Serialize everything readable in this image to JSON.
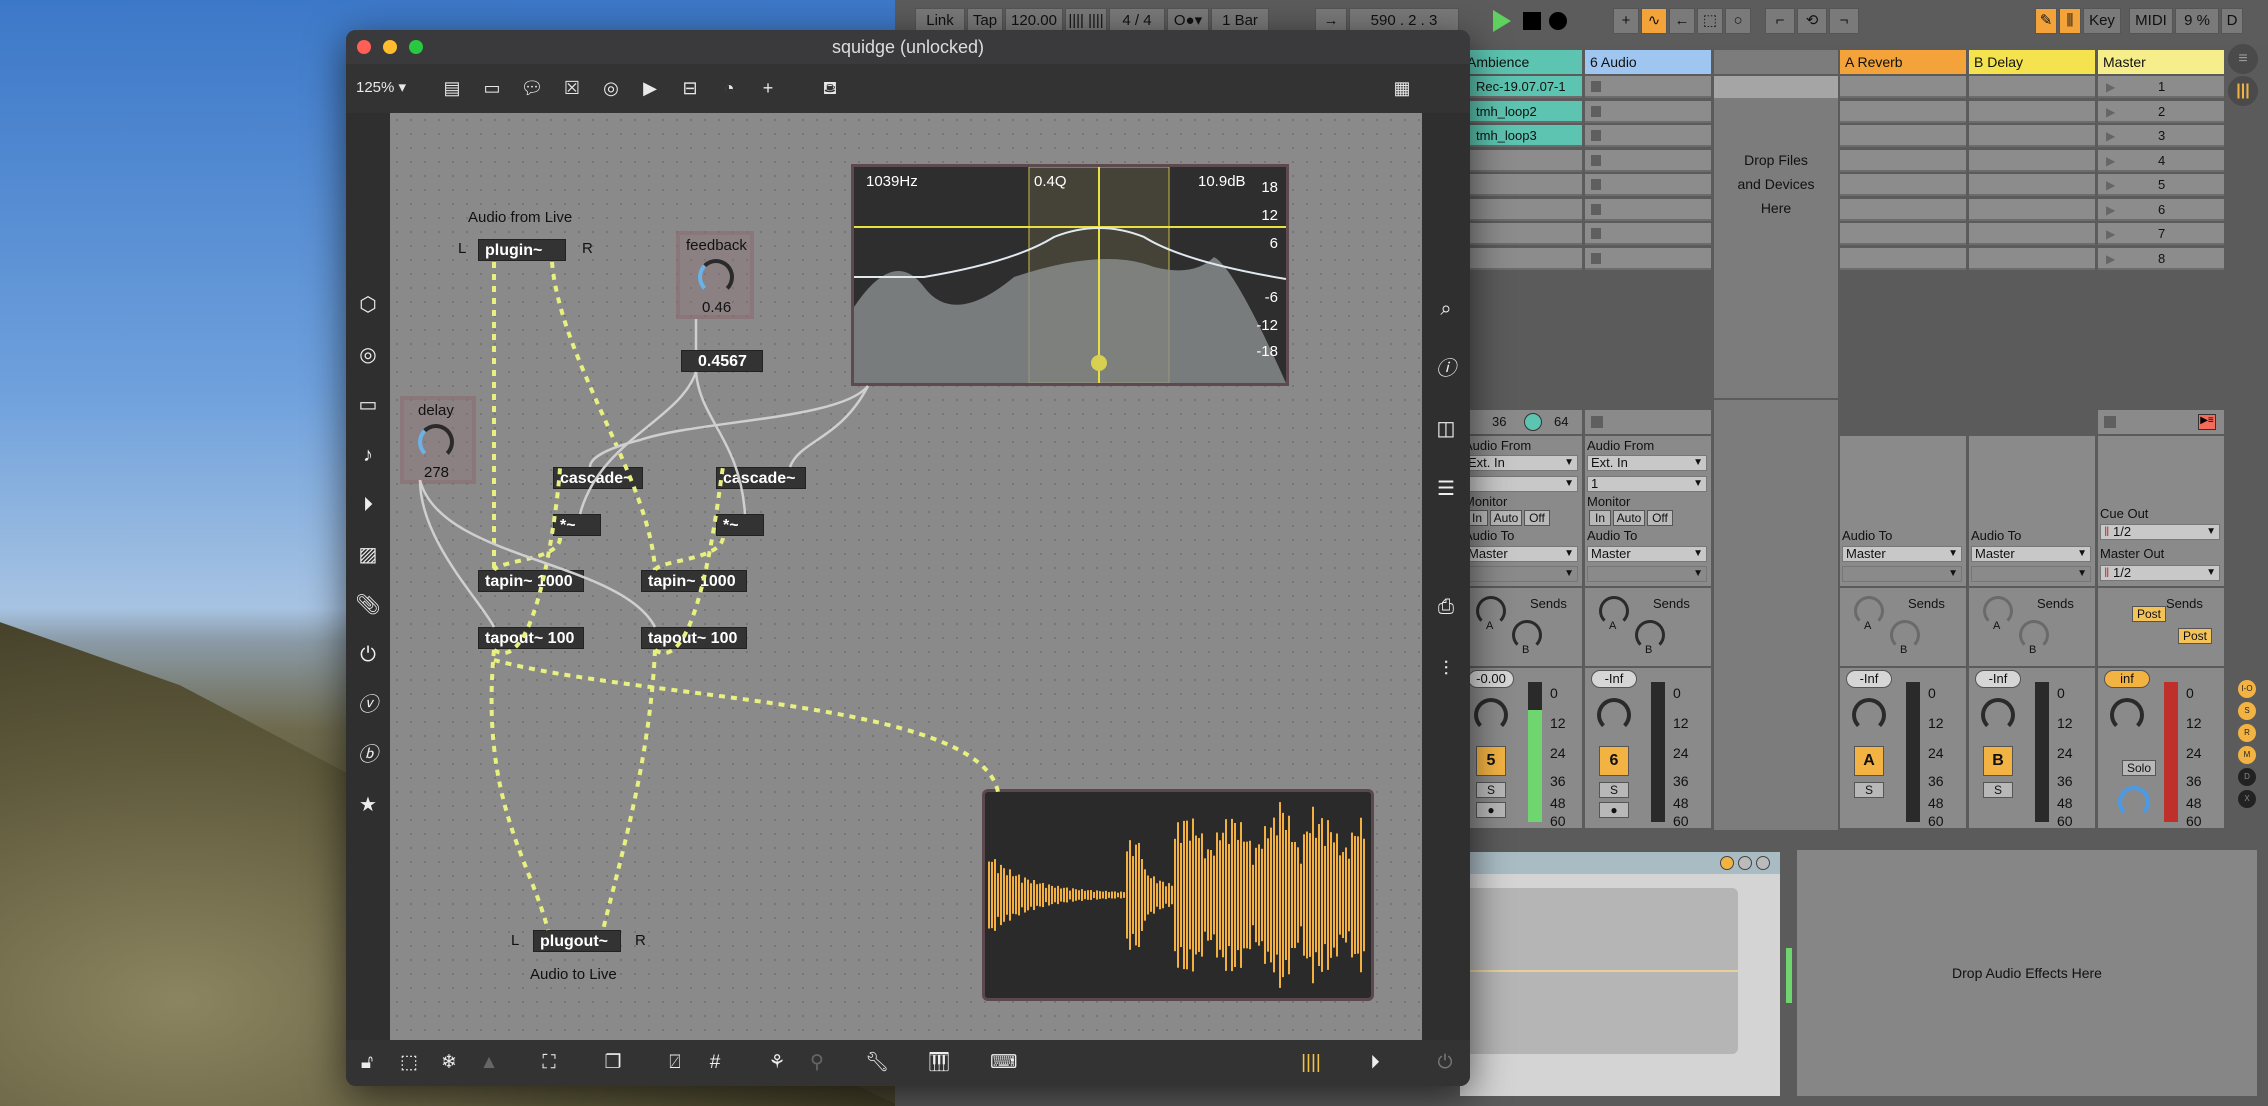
{
  "max_window": {
    "title": "squidge (unlocked)",
    "zoom": "125%",
    "toolbar_icons": [
      "object-box-icon",
      "message-box-icon",
      "comment-icon",
      "toggle-icon",
      "button-icon",
      "play-icon",
      "slider-icon",
      "dial-icon",
      "add-icon",
      "paint-bucket-icon",
      "grid-icon"
    ],
    "left_sidebar_icons": [
      "packages-icon",
      "target-icon",
      "device-icon",
      "music-note-icon",
      "video-icon",
      "image-icon",
      "paperclip-icon",
      "plug-icon",
      "v-icon",
      "b-icon",
      "star-icon"
    ],
    "right_sidebar_icons": [
      "search-icon",
      "info-icon",
      "columns-icon",
      "list-icon",
      "camera-icon",
      "mixer-icon"
    ],
    "bottom_icons": [
      "lock-icon",
      "presentation-icon",
      "freeze-icon",
      "warning-icon",
      "easel-icon",
      "layers-icon",
      "hide-icon",
      "grid-icon",
      "tree-icon",
      "attach-icon",
      "wrench-icon",
      "piano-icon",
      "keyboard-icon",
      "meter-icon",
      "play-circle-icon",
      "power-icon"
    ]
  },
  "patch": {
    "comments": {
      "audio_from_live": "Audio from Live",
      "audio_to_live": "Audio to Live",
      "plugin_L": "L",
      "plugin_R": "R",
      "plugout_L": "L",
      "plugout_R": "R"
    },
    "objects": {
      "plugin": "plugin~",
      "plugout": "plugout~",
      "cascade1": "cascade~",
      "cascade2": "cascade~",
      "mul1": "*~",
      "mul2": "*~",
      "tapin1": "tapin~ 1000",
      "tapin2": "tapin~ 1000",
      "tapout1": "tapout~ 100",
      "tapout2": "tapout~ 100"
    },
    "feedback_dial": {
      "label": "feedback",
      "value": "0.46",
      "fraction": 0.46
    },
    "delay_dial": {
      "label": "delay",
      "value": "278"
    },
    "number_box": "0.4567",
    "filtergraph": {
      "freq": "1039Hz",
      "q": "0.4Q",
      "gain": "10.9dB",
      "db_labels": [
        "18",
        "12",
        "6",
        "-6",
        "-12",
        "-18"
      ]
    }
  },
  "live": {
    "transport": {
      "link": "Link",
      "tap": "Tap",
      "tempo": "120.00",
      "signature": "4 / 4",
      "quantize": "1 Bar",
      "position": "590 .  2 .  3",
      "key": "Key",
      "midi": "MIDI",
      "cpu": "9 %",
      "d": "D"
    },
    "tracks": [
      {
        "name": "Ambience",
        "color": "#5cc4b0",
        "clips": [
          "Rec-19.07.07-1",
          "tmh_loop2",
          "tmh_loop3"
        ]
      },
      {
        "name": "6 Audio",
        "color": "#9fc6f0",
        "clips": []
      },
      {
        "name": "A Reverb",
        "color": "#f3a33a"
      },
      {
        "name": "B Delay",
        "color": "#f4e34e"
      },
      {
        "name": "Master",
        "color": "#f6ee8a"
      }
    ],
    "drop_files": "Drop Files and Devices Here",
    "scenes": [
      "1",
      "2",
      "3",
      "4",
      "5",
      "6",
      "7",
      "8"
    ],
    "io": {
      "input_val1": "36",
      "input_val2": "64",
      "audio_from": "Audio From",
      "ext_in": "Ext. In",
      "channel": "1",
      "monitor": "Monitor",
      "mon_in": "In",
      "mon_auto": "Auto",
      "mon_off": "Off",
      "audio_to": "Audio To",
      "master": "Master",
      "cue_out": "Cue Out",
      "cue_val": "1/2",
      "master_out": "Master Out",
      "master_out_val": "1/2",
      "sends": "Sends",
      "post": "Post",
      "send_a": "A",
      "send_b": "B"
    },
    "mixer": {
      "volumes": [
        "-0.00",
        "-Inf",
        "-Inf",
        "-Inf",
        "inf"
      ],
      "track_buttons": [
        "5",
        "6",
        "A",
        "B"
      ],
      "solo": "S",
      "solo_master": "Solo",
      "scale": [
        "0",
        "12",
        "24",
        "36",
        "48",
        "60"
      ],
      "side_buttons": [
        "I-O",
        "S",
        "R",
        "M",
        "D",
        "X"
      ]
    },
    "device_drop": "Drop Audio Effects Here"
  }
}
